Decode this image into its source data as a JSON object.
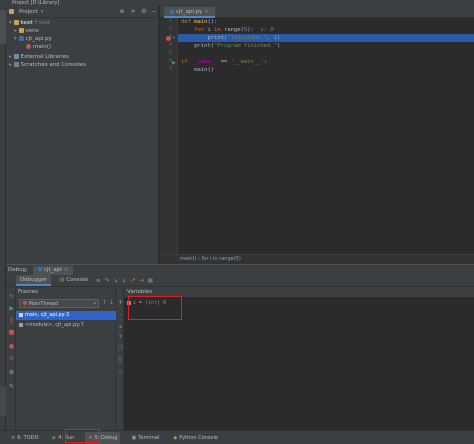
{
  "window": {
    "title": "Project [D:\\Library]"
  },
  "project": {
    "header_label": "Project",
    "tree": [
      {
        "label": "test",
        "detail": "F:\\test",
        "kind": "folder",
        "indent": 0
      },
      {
        "label": "venv",
        "detail": "",
        "kind": "folder",
        "indent": 1
      },
      {
        "label": "cjt_api.py",
        "detail": "",
        "kind": "py",
        "indent": 1
      },
      {
        "label": "main()",
        "detail": "",
        "kind": "fn",
        "indent": 2
      },
      {
        "label": "External Libraries",
        "detail": "",
        "kind": "lib",
        "indent": 0
      },
      {
        "label": "Scratches and Consoles",
        "detail": "",
        "kind": "lib",
        "indent": 0
      }
    ]
  },
  "editor": {
    "tab_label": "cjt_api.py",
    "line_numbers": [
      "1",
      "2",
      "3",
      "4",
      "5",
      "6",
      "7"
    ],
    "breadcrumb": "main()  ›  for i in range(5)",
    "inline_hint": "i: 0"
  },
  "debug": {
    "label": "Debug:",
    "config_tab": "cjt_api",
    "tabs": [
      "Debugger",
      "Console"
    ],
    "frames_header": "Frames",
    "thread": "MainThread",
    "frames": [
      "main, cjt_api.py:3",
      "<module>, cjt_api.py:7"
    ],
    "variables_header": "Variables",
    "variable": {
      "name": "i",
      "type": "{int}",
      "value": "0"
    }
  },
  "statusbar": {
    "items": [
      "6: TODO",
      "4: Run",
      "5: Debug",
      "Terminal",
      "Python Console"
    ]
  },
  "colors": {
    "highlight": "#2d5aa8",
    "annotation_box": "#e02020",
    "keyword": "#cc7832",
    "string": "#6a8759",
    "number": "#6897bb"
  }
}
